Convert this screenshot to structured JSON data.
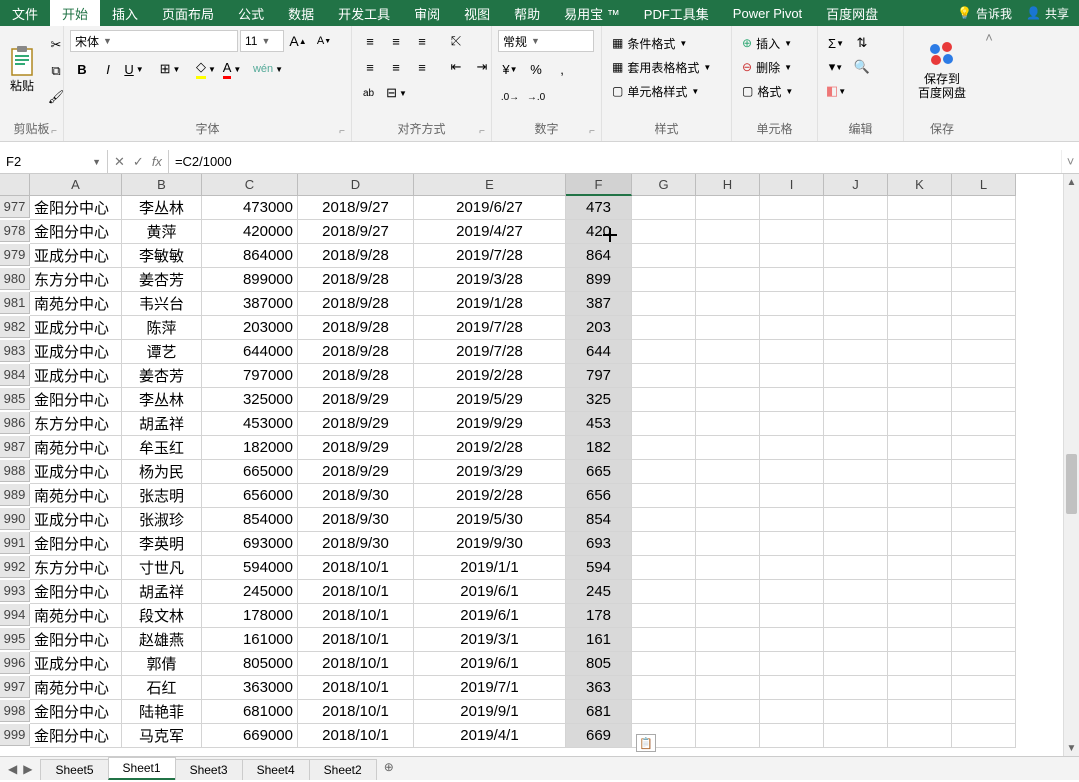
{
  "tabs": {
    "items": [
      "文件",
      "开始",
      "插入",
      "页面布局",
      "公式",
      "数据",
      "开发工具",
      "审阅",
      "视图",
      "帮助",
      "易用宝 ™",
      "PDF工具集",
      "Power Pivot",
      "百度网盘"
    ],
    "active": 1,
    "tell_me": "告诉我",
    "share": "共享"
  },
  "ribbon": {
    "clipboard": {
      "paste": "粘贴",
      "label": "剪贴板"
    },
    "font": {
      "name": "宋体",
      "size": "11",
      "bold": "B",
      "italic": "I",
      "underline": "U",
      "label": "字体"
    },
    "align": {
      "label": "对齐方式",
      "wrap": "ab",
      "merge": "合"
    },
    "number": {
      "format": "常规",
      "label": "数字",
      "percent": "%",
      "comma": ",",
      "dec_inc": ".0",
      "dec_dec": ".00"
    },
    "styles": {
      "cond": "条件格式",
      "table": "套用表格格式",
      "cell": "单元格样式",
      "label": "样式"
    },
    "cells": {
      "insert": "插入",
      "delete": "删除",
      "format": "格式",
      "label": "单元格"
    },
    "editing": {
      "label": "编辑"
    },
    "baidu": {
      "line1": "保存到",
      "line2": "百度网盘",
      "label": "保存"
    }
  },
  "formula": {
    "namebox": "F2",
    "value": "=C2/1000",
    "fx": "fx"
  },
  "grid": {
    "cols": [
      "A",
      "B",
      "C",
      "D",
      "E",
      "F",
      "G",
      "H",
      "I",
      "J",
      "K",
      "L"
    ],
    "selectedCol": "F",
    "rows": [
      {
        "n": 977,
        "a": "金阳分中心",
        "b": "李丛林",
        "c": "473000",
        "d": "2018/9/27",
        "e": "2019/6/27",
        "f": "473"
      },
      {
        "n": 978,
        "a": "金阳分中心",
        "b": "黄萍",
        "c": "420000",
        "d": "2018/9/27",
        "e": "2019/4/27",
        "f": "420"
      },
      {
        "n": 979,
        "a": "亚成分中心",
        "b": "李敏敏",
        "c": "864000",
        "d": "2018/9/28",
        "e": "2019/7/28",
        "f": "864"
      },
      {
        "n": 980,
        "a": "东方分中心",
        "b": "姜杏芳",
        "c": "899000",
        "d": "2018/9/28",
        "e": "2019/3/28",
        "f": "899"
      },
      {
        "n": 981,
        "a": "南苑分中心",
        "b": "韦兴台",
        "c": "387000",
        "d": "2018/9/28",
        "e": "2019/1/28",
        "f": "387"
      },
      {
        "n": 982,
        "a": "亚成分中心",
        "b": "陈萍",
        "c": "203000",
        "d": "2018/9/28",
        "e": "2019/7/28",
        "f": "203"
      },
      {
        "n": 983,
        "a": "亚成分中心",
        "b": "谭艺",
        "c": "644000",
        "d": "2018/9/28",
        "e": "2019/7/28",
        "f": "644"
      },
      {
        "n": 984,
        "a": "亚成分中心",
        "b": "姜杏芳",
        "c": "797000",
        "d": "2018/9/28",
        "e": "2019/2/28",
        "f": "797"
      },
      {
        "n": 985,
        "a": "金阳分中心",
        "b": "李丛林",
        "c": "325000",
        "d": "2018/9/29",
        "e": "2019/5/29",
        "f": "325"
      },
      {
        "n": 986,
        "a": "东方分中心",
        "b": "胡孟祥",
        "c": "453000",
        "d": "2018/9/29",
        "e": "2019/9/29",
        "f": "453"
      },
      {
        "n": 987,
        "a": "南苑分中心",
        "b": "牟玉红",
        "c": "182000",
        "d": "2018/9/29",
        "e": "2019/2/28",
        "f": "182"
      },
      {
        "n": 988,
        "a": "亚成分中心",
        "b": "杨为民",
        "c": "665000",
        "d": "2018/9/29",
        "e": "2019/3/29",
        "f": "665"
      },
      {
        "n": 989,
        "a": "南苑分中心",
        "b": "张志明",
        "c": "656000",
        "d": "2018/9/30",
        "e": "2019/2/28",
        "f": "656"
      },
      {
        "n": 990,
        "a": "亚成分中心",
        "b": "张淑珍",
        "c": "854000",
        "d": "2018/9/30",
        "e": "2019/5/30",
        "f": "854"
      },
      {
        "n": 991,
        "a": "金阳分中心",
        "b": "李英明",
        "c": "693000",
        "d": "2018/9/30",
        "e": "2019/9/30",
        "f": "693"
      },
      {
        "n": 992,
        "a": "东方分中心",
        "b": "寸世凡",
        "c": "594000",
        "d": "2018/10/1",
        "e": "2019/1/1",
        "f": "594"
      },
      {
        "n": 993,
        "a": "金阳分中心",
        "b": "胡孟祥",
        "c": "245000",
        "d": "2018/10/1",
        "e": "2019/6/1",
        "f": "245"
      },
      {
        "n": 994,
        "a": "南苑分中心",
        "b": "段文林",
        "c": "178000",
        "d": "2018/10/1",
        "e": "2019/6/1",
        "f": "178"
      },
      {
        "n": 995,
        "a": "金阳分中心",
        "b": "赵雄燕",
        "c": "161000",
        "d": "2018/10/1",
        "e": "2019/3/1",
        "f": "161"
      },
      {
        "n": 996,
        "a": "亚成分中心",
        "b": "郭倩",
        "c": "805000",
        "d": "2018/10/1",
        "e": "2019/6/1",
        "f": "805"
      },
      {
        "n": 997,
        "a": "南苑分中心",
        "b": "石红",
        "c": "363000",
        "d": "2018/10/1",
        "e": "2019/7/1",
        "f": "363"
      },
      {
        "n": 998,
        "a": "金阳分中心",
        "b": "陆艳菲",
        "c": "681000",
        "d": "2018/10/1",
        "e": "2019/9/1",
        "f": "681"
      },
      {
        "n": 999,
        "a": "金阳分中心",
        "b": "马克军",
        "c": "669000",
        "d": "2018/10/1",
        "e": "2019/4/1",
        "f": "669"
      }
    ]
  },
  "sheets": {
    "items": [
      "Sheet5",
      "Sheet1",
      "Sheet3",
      "Sheet4",
      "Sheet2"
    ],
    "active": 1
  }
}
